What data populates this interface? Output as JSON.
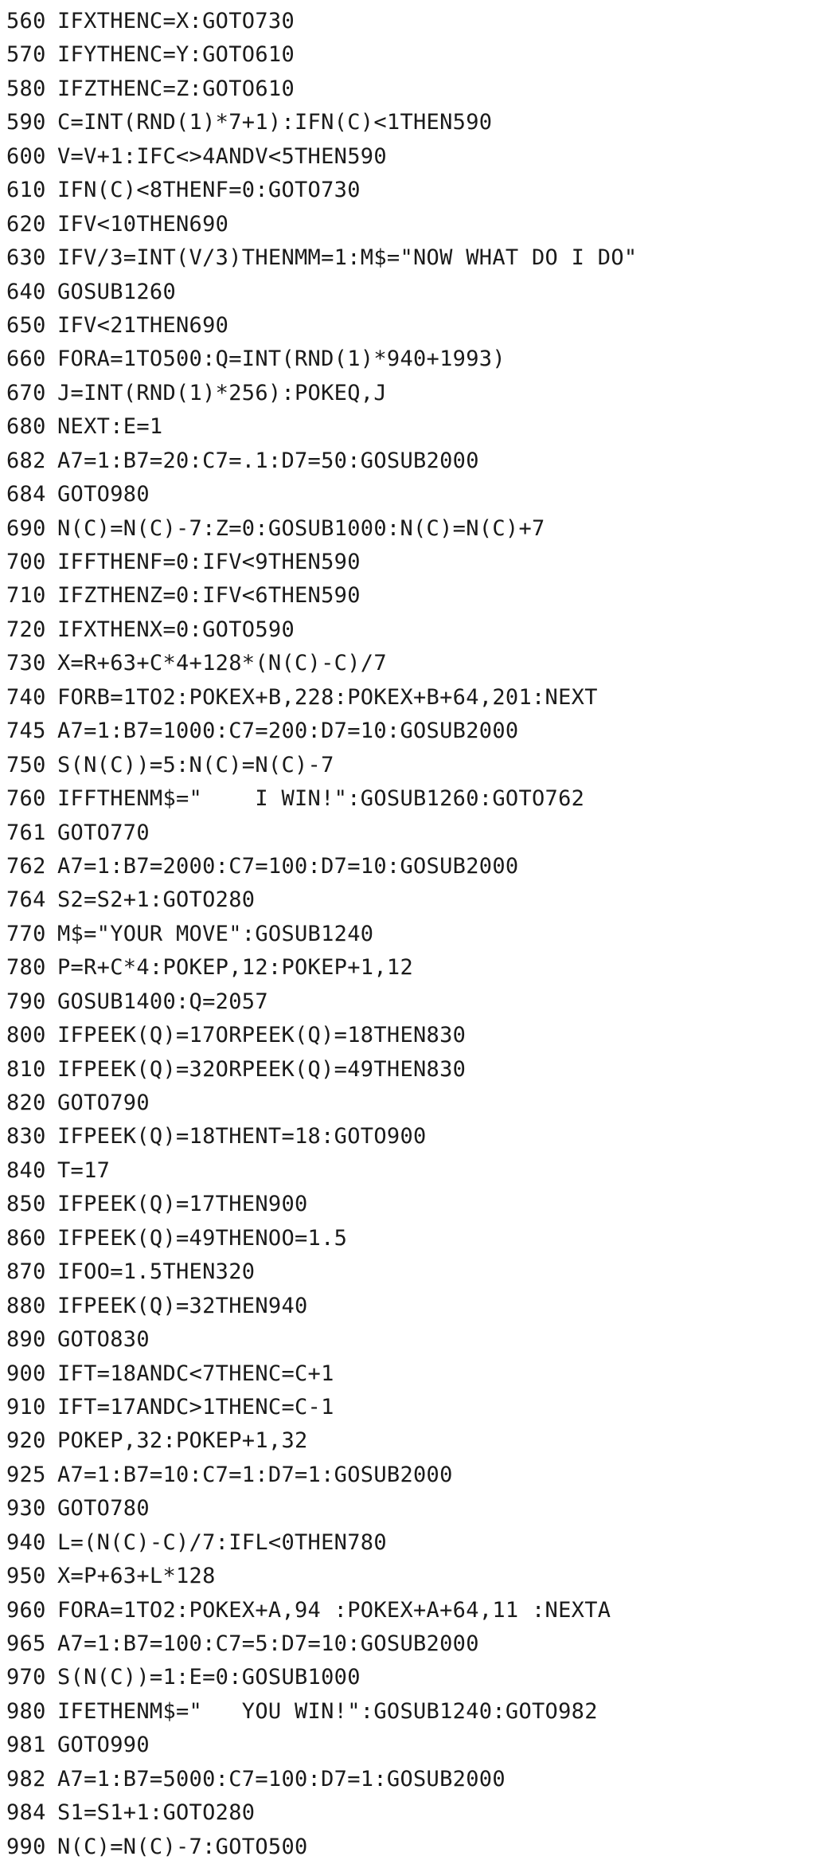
{
  "listing": {
    "lines": [
      {
        "num": "560",
        "code": "IFXTHENC=X:GOTO730"
      },
      {
        "num": "570",
        "code": "IFYTHENC=Y:GOTO610"
      },
      {
        "num": "580",
        "code": "IFZTHENC=Z:GOTO610"
      },
      {
        "num": "590",
        "code": "C=INT(RND(1)*7+1):IFN(C)<1THEN590"
      },
      {
        "num": "600",
        "code": "V=V+1:IFC<>4ANDV<5THEN590"
      },
      {
        "num": "610",
        "code": "IFN(C)<8THENF=0:GOTO730"
      },
      {
        "num": "620",
        "code": "IFV<10THEN690"
      },
      {
        "num": "630",
        "code": "IFV/3=INT(V/3)THENMM=1:M$=\"NOW WHAT DO I DO\""
      },
      {
        "num": "640",
        "code": "GOSUB1260"
      },
      {
        "num": "650",
        "code": "IFV<21THEN690"
      },
      {
        "num": "660",
        "code": "FORA=1TO500:Q=INT(RND(1)*940+1993)"
      },
      {
        "num": "670",
        "code": "J=INT(RND(1)*256):POKEQ,J"
      },
      {
        "num": "680",
        "code": "NEXT:E=1"
      },
      {
        "num": "682",
        "code": "A7=1:B7=20:C7=.1:D7=50:GOSUB2000"
      },
      {
        "num": "684",
        "code": "GOTO980"
      },
      {
        "num": "690",
        "code": "N(C)=N(C)-7:Z=0:GOSUB1000:N(C)=N(C)+7"
      },
      {
        "num": "700",
        "code": "IFFTHENF=0:IFV<9THEN590"
      },
      {
        "num": "710",
        "code": "IFZTHENZ=0:IFV<6THEN590"
      },
      {
        "num": "720",
        "code": "IFXTHENX=0:GOTO590"
      },
      {
        "num": "730",
        "code": "X=R+63+C*4+128*(N(C)-C)/7"
      },
      {
        "num": "740",
        "code": "FORB=1TO2:POKEX+B,228:POKEX+B+64,201:NEXT"
      },
      {
        "num": "745",
        "code": "A7=1:B7=1000:C7=200:D7=10:GOSUB2000"
      },
      {
        "num": "750",
        "code": "S(N(C))=5:N(C)=N(C)-7"
      },
      {
        "num": "760",
        "code": "IFFTHENM$=\"    I WIN!\":GOSUB1260:GOTO762"
      },
      {
        "num": "761",
        "code": "GOTO770"
      },
      {
        "num": "762",
        "code": "A7=1:B7=2000:C7=100:D7=10:GOSUB2000"
      },
      {
        "num": "764",
        "code": "S2=S2+1:GOTO280"
      },
      {
        "num": "770",
        "code": "M$=\"YOUR MOVE\":GOSUB1240"
      },
      {
        "num": "780",
        "code": "P=R+C*4:POKEP,12:POKEP+1,12"
      },
      {
        "num": "790",
        "code": "GOSUB1400:Q=2057"
      },
      {
        "num": "800",
        "code": "IFPEEK(Q)=17ORPEEK(Q)=18THEN830"
      },
      {
        "num": "810",
        "code": "IFPEEK(Q)=32ORPEEK(Q)=49THEN830"
      },
      {
        "num": "820",
        "code": "GOTO790"
      },
      {
        "num": "830",
        "code": "IFPEEK(Q)=18THENT=18:GOTO900"
      },
      {
        "num": "840",
        "code": "T=17"
      },
      {
        "num": "850",
        "code": "IFPEEK(Q)=17THEN900"
      },
      {
        "num": "860",
        "code": "IFPEEK(Q)=49THENOO=1.5"
      },
      {
        "num": "870",
        "code": "IFOO=1.5THEN320"
      },
      {
        "num": "880",
        "code": "IFPEEK(Q)=32THEN940"
      },
      {
        "num": "890",
        "code": "GOTO830"
      },
      {
        "num": "900",
        "code": "IFT=18ANDC<7THENC=C+1"
      },
      {
        "num": "910",
        "code": "IFT=17ANDC>1THENC=C-1"
      },
      {
        "num": "920",
        "code": "POKEP,32:POKEP+1,32"
      },
      {
        "num": "925",
        "code": "A7=1:B7=10:C7=1:D7=1:GOSUB2000"
      },
      {
        "num": "930",
        "code": "GOTO780"
      },
      {
        "num": "940",
        "code": "L=(N(C)-C)/7:IFL<0THEN780"
      },
      {
        "num": "950",
        "code": "X=P+63+L*128"
      },
      {
        "num": "960",
        "code": "FORA=1TO2:POKEX+A,94 :POKEX+A+64,11 :NEXTA"
      },
      {
        "num": "965",
        "code": "A7=1:B7=100:C7=5:D7=10:GOSUB2000"
      },
      {
        "num": "970",
        "code": "S(N(C))=1:E=0:GOSUB1000"
      },
      {
        "num": "980",
        "code": "IFETHENM$=\"   YOU WIN!\":GOSUB1240:GOTO982"
      },
      {
        "num": "981",
        "code": "GOTO990"
      },
      {
        "num": "982",
        "code": "A7=1:B7=5000:C7=100:D7=1:GOSUB2000"
      },
      {
        "num": "984",
        "code": "S1=S1+1:GOTO280"
      },
      {
        "num": "990",
        "code": "N(C)=N(C)-7:GOTO500"
      }
    ]
  }
}
